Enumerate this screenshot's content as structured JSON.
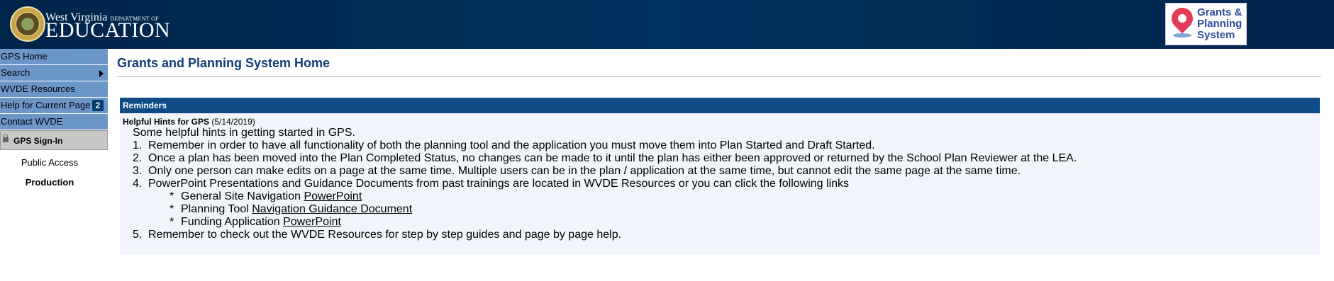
{
  "header": {
    "logo_line1": "West Virginia",
    "logo_line1_small": "DEPARTMENT OF",
    "logo_line2": "EDUCATION",
    "gps_logo": {
      "line1": "Grants &",
      "line2": "Planning",
      "line3": "System"
    }
  },
  "sidebar": {
    "items": [
      {
        "label": "GPS Home"
      },
      {
        "label": "Search"
      },
      {
        "label": "WVDE Resources"
      },
      {
        "label": "Help for Current Page",
        "badge": "2"
      },
      {
        "label": "Contact WVDE"
      }
    ],
    "signin_label": "GPS Sign-In",
    "access_label": "Public Access",
    "env_label": "Production"
  },
  "main": {
    "title": "Grants and Planning System Home",
    "reminders": {
      "header": "Reminders",
      "hint_title": "Helpful Hints for GPS",
      "hint_date": "(5/14/2019)",
      "intro": "Some helpful hints in getting started in GPS.",
      "items": [
        {
          "num": "1.",
          "text": "Remember in order to have all functionality of both the planning tool and the application you must move them into Plan Started and Draft Started."
        },
        {
          "num": "2.",
          "text": "Once a plan has been moved into the Plan Completed Status, no changes can be made to it until the plan has either been approved or returned by the School Plan Reviewer at the LEA."
        },
        {
          "num": "3.",
          "text": "Only one person can make edits on a page at the same time.  Multiple users can be in the plan / application at the same time, but cannot edit the same page at the same time."
        },
        {
          "num": "4.",
          "text": "PowerPoint Presentations and Guidance Documents from past trainings are located in WVDE Resources or you can click the following links"
        },
        {
          "num": "5.",
          "text": "Remember to check out the WVDE Resources for step by step guides and page by page help."
        }
      ],
      "links": [
        {
          "prefix": "General Site Navigation",
          "link": "PowerPoint"
        },
        {
          "prefix": "Planning Tool",
          "link": "Navigation Guidance Document"
        },
        {
          "prefix": "Funding Application",
          "link": "PowerPoint"
        }
      ]
    }
  }
}
